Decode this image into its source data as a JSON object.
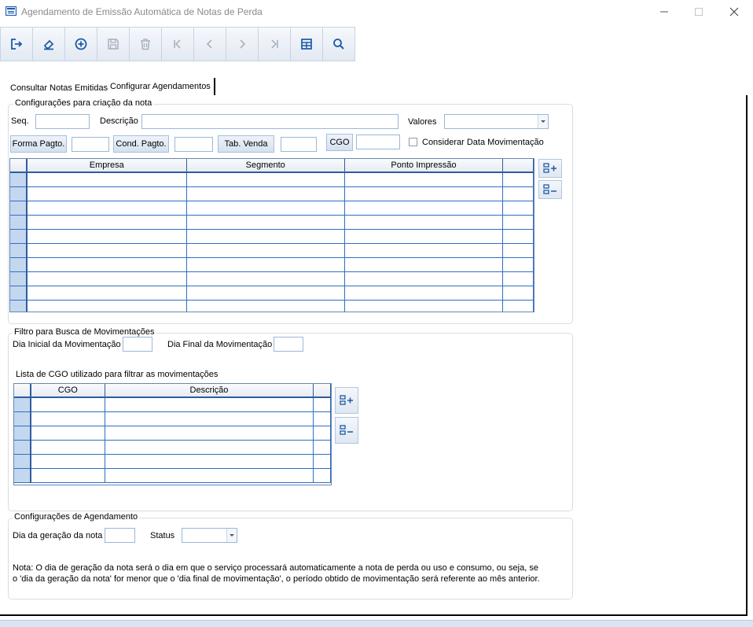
{
  "window": {
    "title": "Agendamento de Emissão Automática de Notas de Perda"
  },
  "toolbar": {
    "buttons": [
      {
        "name": "exit-button",
        "icon": "exit-icon",
        "enabled": true
      },
      {
        "name": "clear-button",
        "icon": "eraser-icon",
        "enabled": true
      },
      {
        "name": "add-button",
        "icon": "plus-circle-icon",
        "enabled": true
      },
      {
        "name": "save-button",
        "icon": "save-icon",
        "enabled": false
      },
      {
        "name": "delete-button",
        "icon": "trash-icon",
        "enabled": false
      },
      {
        "name": "first-button",
        "icon": "first-icon",
        "enabled": false
      },
      {
        "name": "prev-button",
        "icon": "prev-icon",
        "enabled": false
      },
      {
        "name": "next-button",
        "icon": "next-icon",
        "enabled": false
      },
      {
        "name": "last-button",
        "icon": "last-icon",
        "enabled": false
      },
      {
        "name": "grid-button",
        "icon": "table-icon",
        "enabled": true
      },
      {
        "name": "search-button",
        "icon": "search-icon",
        "enabled": true
      }
    ]
  },
  "tabs": [
    {
      "label": "Consultar Notas Emitidas",
      "active": false
    },
    {
      "label": "Configurar Agendamentos",
      "active": true
    }
  ],
  "config_nota": {
    "title": "Configurações para criação da nota",
    "seq_label": "Seq.",
    "seq_value": "",
    "descricao_label": "Descrição",
    "descricao_value": "",
    "valores_label": "Valores",
    "valores_value": "",
    "forma_pagto_label": "Forma Pagto.",
    "forma_pagto_value": "",
    "cond_pagto_label": "Cond. Pagto.",
    "cond_pagto_value": "",
    "tab_venda_label": "Tab. Venda",
    "tab_venda_value": "",
    "cgo_label": "CGO",
    "cgo_value": "",
    "considerar_label": "Considerar Data Movimentação",
    "considerar_checked": false,
    "grid": {
      "columns": [
        "Empresa",
        "Segmento",
        "Ponto Impressão"
      ],
      "row_count": 10
    }
  },
  "filtro": {
    "title": "Filtro para Busca de Movimentações",
    "dia_inicial_label": "Dia Inicial da Movimentação",
    "dia_inicial_value": "",
    "dia_final_label": "Dia Final da Movimentação",
    "dia_final_value": "",
    "lista_label": "Lista de CGO utilizado para filtrar as movimentações",
    "grid": {
      "columns": [
        "CGO",
        "Descrição"
      ],
      "row_count": 6
    }
  },
  "agendamento": {
    "title": "Configurações de Agendamento",
    "dia_geracao_label": "Dia da geração da nota",
    "dia_geracao_value": "",
    "status_label": "Status",
    "status_value": "",
    "note_line1": "Nota: O dia de geração da nota será o dia em que o serviço processará automaticamente a nota de perda ou uso e consumo, ou seja, se",
    "note_line2": "o 'dia da geração da nota' for menor que o 'dia final de movimentação', o período obtido de movimentação será referente ao mês anterior."
  },
  "colors": {
    "accent": "#1e5aa8",
    "grid_line": "#2f6fc1",
    "indicator": "#c3d8ef",
    "disabled_icon": "#a9b2bd"
  }
}
